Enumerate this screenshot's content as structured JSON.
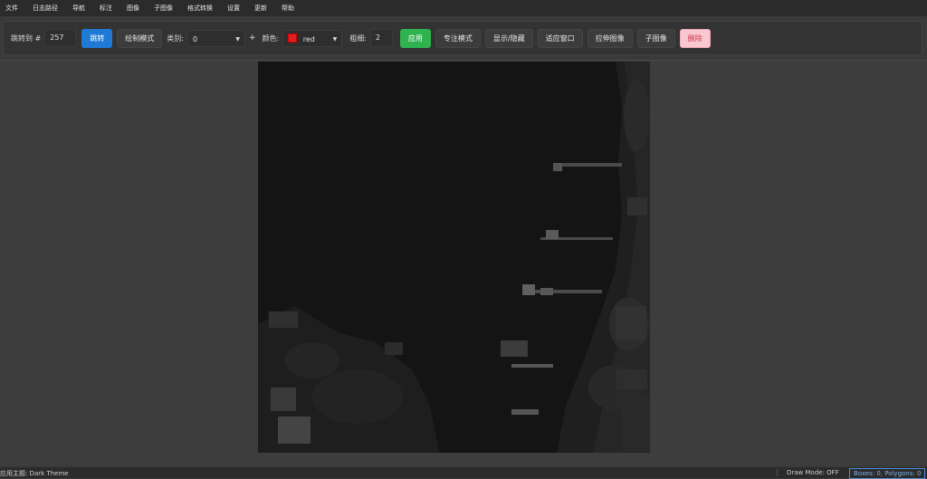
{
  "menu": [
    "文件",
    "日志路径",
    "导航",
    "标注",
    "图像",
    "子图像",
    "格式转换",
    "设置",
    "更新",
    "帮助"
  ],
  "toolbar": {
    "jump_label": "跳转到 #",
    "jump_value": "257",
    "jump_button": "跳转",
    "draw_mode_button": "绘制模式",
    "class_label": "类别:",
    "class_value": "0",
    "add_label": "+",
    "color_label": "颜色:",
    "color_value": "red",
    "thickness_label": "粗细:",
    "thickness_value": "2",
    "apply_button": "应用",
    "focus_button": "专注模式",
    "toggle_button": "显示/隐藏",
    "fit_button": "适应窗口",
    "stretch_button": "拉伸图像",
    "subimage_button": "子图像",
    "delete_button": "删除"
  },
  "colors": {
    "accent_blue": "#1f7ad6",
    "apply_green": "#2fb24f",
    "delete_pink": "#f8c7cf",
    "swatch_red": "#e02020"
  },
  "status": {
    "theme": "应用主题: Dark Theme",
    "draw_mode": "Draw Mode: OFF",
    "counts": "Boxes: 0, Polygons: 0"
  }
}
